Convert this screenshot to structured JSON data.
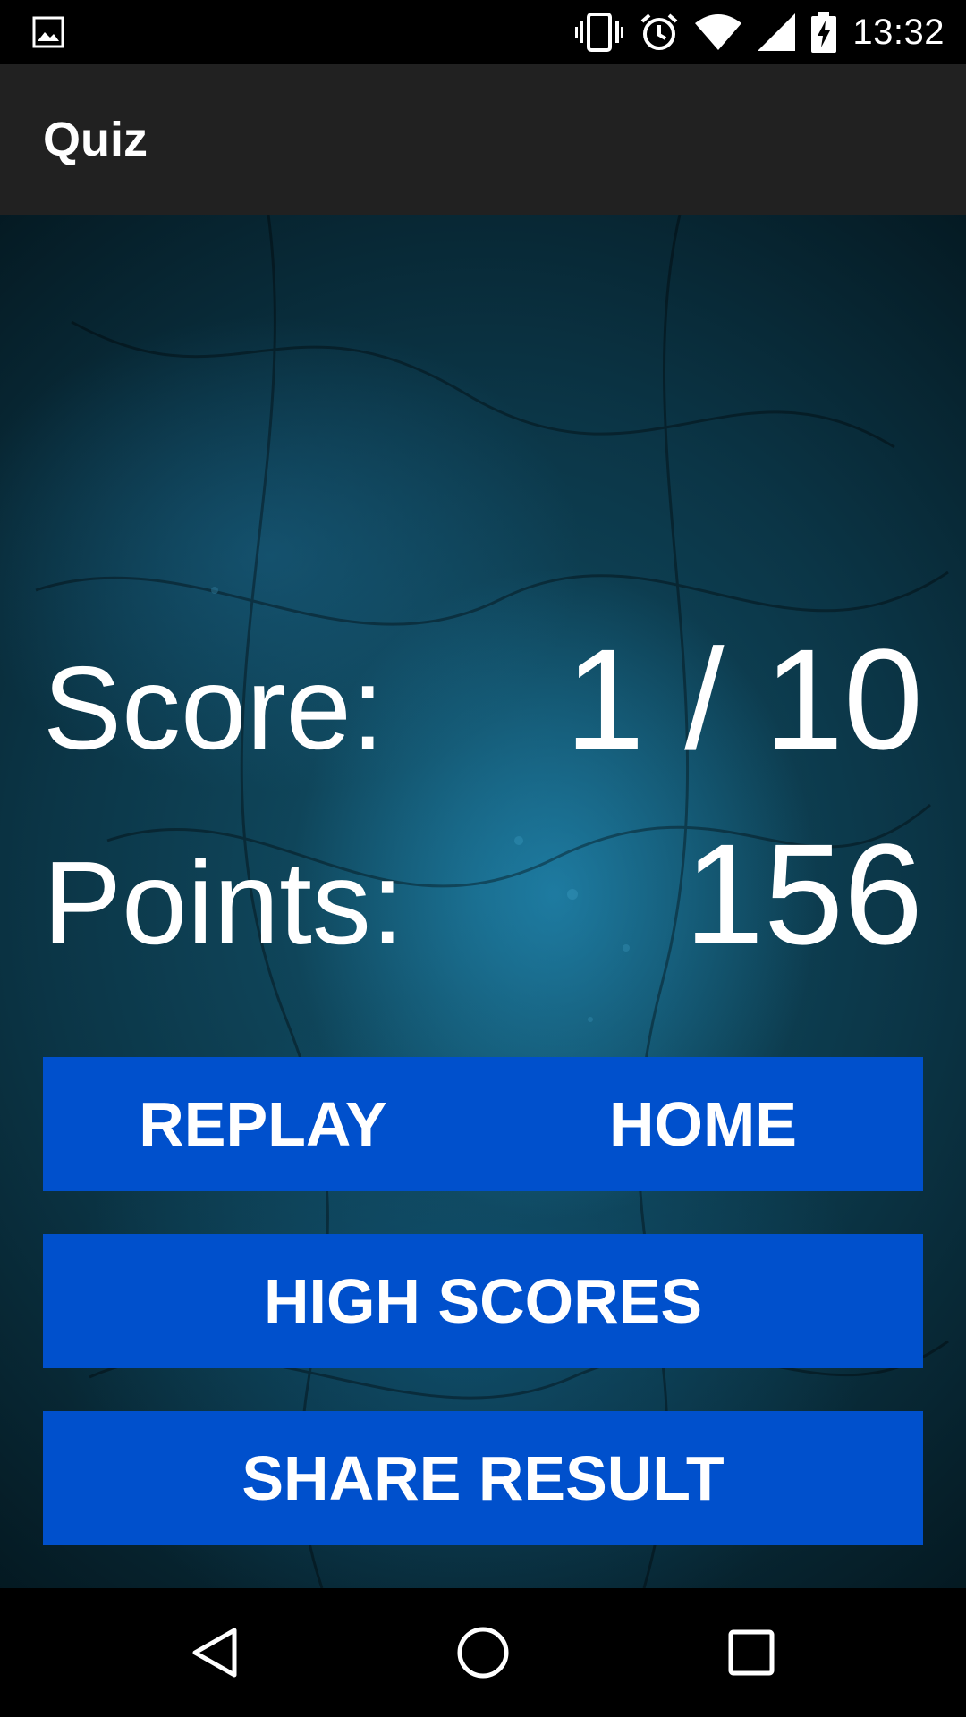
{
  "status_bar": {
    "time": "13:32",
    "icons": [
      "gallery-icon",
      "vibrate-icon",
      "alarm-icon",
      "wifi-icon",
      "cell-signal-icon",
      "battery-charging-icon"
    ]
  },
  "app_bar": {
    "title": "Quiz"
  },
  "results": {
    "score_label": "Score:",
    "score_value": "1 / 10",
    "points_label": "Points:",
    "points_value": "156"
  },
  "buttons": {
    "replay": "REPLAY",
    "home": "HOME",
    "high_scores": "HIGH SCORES",
    "share_result": "SHARE RESULT"
  },
  "nav_bar": {
    "icons": [
      "back-icon",
      "home-circle-icon",
      "recents-icon"
    ]
  },
  "colors": {
    "button_blue": "#0050cc",
    "app_bar": "#212121",
    "background": "#0b3546"
  }
}
